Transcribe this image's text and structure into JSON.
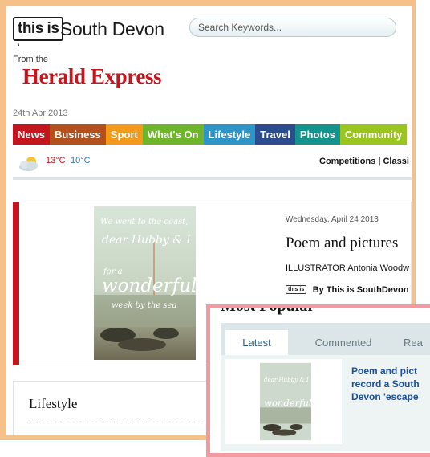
{
  "header": {
    "logo_badge": "this is",
    "logo_site": "South Devon",
    "from_the": "From the",
    "newspaper": "Herald Express",
    "date": "24th Apr 2013"
  },
  "search": {
    "placeholder": "Search Keywords..."
  },
  "nav": {
    "items": [
      {
        "label": "News",
        "color": "#c4161c"
      },
      {
        "label": "Business",
        "color": "#b4501b"
      },
      {
        "label": "Sport",
        "color": "#f39a1b"
      },
      {
        "label": "What's On",
        "color": "#6fb52c"
      },
      {
        "label": "Lifestyle",
        "color": "#2f95c9"
      },
      {
        "label": "Travel",
        "color": "#2b4d8e"
      },
      {
        "label": "Photos",
        "color": "#12948c"
      },
      {
        "label": "Community",
        "color": "#9ac41e"
      }
    ]
  },
  "weather": {
    "high": "13°C",
    "low": "10°C"
  },
  "top_links": "Competitions | Classi",
  "feature": {
    "date": "Wednesday, April 24 2013",
    "title": "Poem and pictures",
    "byline": "ILLUSTRATOR Antonia Woodw",
    "source_badge": "this is",
    "source_label": "By This is SouthDevon",
    "image_lines": [
      "We went to the coast,",
      "dear Hubby & I",
      "for a",
      "wonderful",
      "week by the sea"
    ]
  },
  "lifestyle": {
    "title": "Lifestyle"
  },
  "popular": {
    "heading": "Most Popular",
    "tabs": [
      "Latest",
      "Commented",
      "Rea"
    ],
    "active_tab": "Latest",
    "item_lines": [
      "Poem and pict",
      "record a South",
      "Devon 'escape"
    ]
  },
  "colors": {
    "brand_red": "#c4161c",
    "link_blue": "#1a4f9c",
    "frame_orange": "#f5c089",
    "frame_pink": "#f19aa0"
  }
}
